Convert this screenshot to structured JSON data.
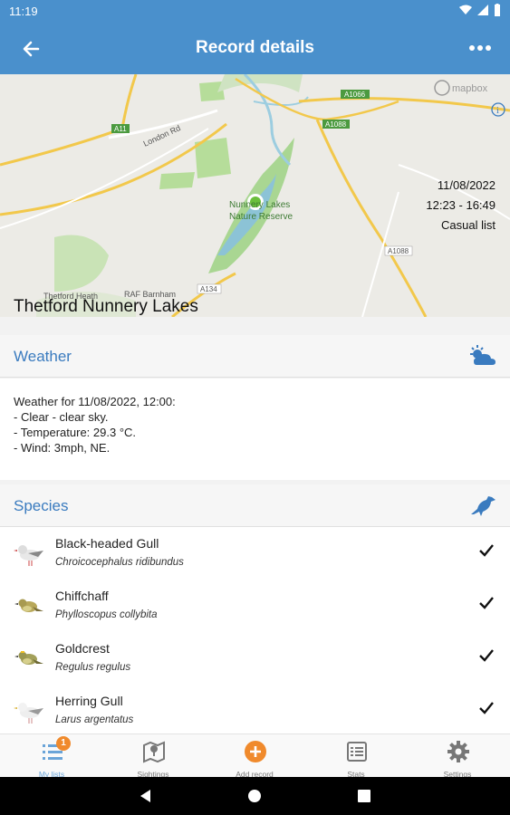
{
  "status": {
    "time": "11:19"
  },
  "header": {
    "title": "Record details"
  },
  "map": {
    "attribution": "mapbox",
    "place_label_1": "Nunnery Lakes",
    "place_label_2": "Nature Reserve",
    "road_labels": [
      "A11",
      "London Rd",
      "A1066",
      "A1088",
      "A1088",
      "A134",
      "Thetford Heath",
      "RAF Barnham"
    ]
  },
  "record": {
    "date": "11/08/2022",
    "time_range": "12:23 - 16:49",
    "list_type": "Casual list",
    "location": "Thetford Nunnery Lakes"
  },
  "weather": {
    "section_title": "Weather",
    "icon": "weather-icon",
    "lines": [
      "Weather for 11/08/2022, 12:00:",
      "- Clear - clear sky.",
      "- Temperature: 29.3 °C.",
      "- Wind: 3mph, NE."
    ]
  },
  "species": {
    "section_title": "Species",
    "icon": "bird-icon",
    "items": [
      {
        "name": "Black-headed Gull",
        "scientific": "Chroicocephalus ridibundus",
        "checked": true
      },
      {
        "name": "Chiffchaff",
        "scientific": "Phylloscopus collybita",
        "checked": true
      },
      {
        "name": "Goldcrest",
        "scientific": "Regulus regulus",
        "checked": true
      },
      {
        "name": "Herring Gull",
        "scientific": "Larus argentatus",
        "checked": true
      }
    ]
  },
  "nav": {
    "items": [
      {
        "label": "My lists",
        "icon": "list-icon",
        "badge": "1"
      },
      {
        "label": "Sightings",
        "icon": "map-icon"
      },
      {
        "label": "Add record",
        "icon": "add-icon"
      },
      {
        "label": "Stats",
        "icon": "stats-icon"
      },
      {
        "label": "Settings",
        "icon": "gear-icon"
      }
    ]
  },
  "colors": {
    "primary": "#4a90cc",
    "accent": "#f08a2c",
    "section_text": "#3a7bbf"
  }
}
